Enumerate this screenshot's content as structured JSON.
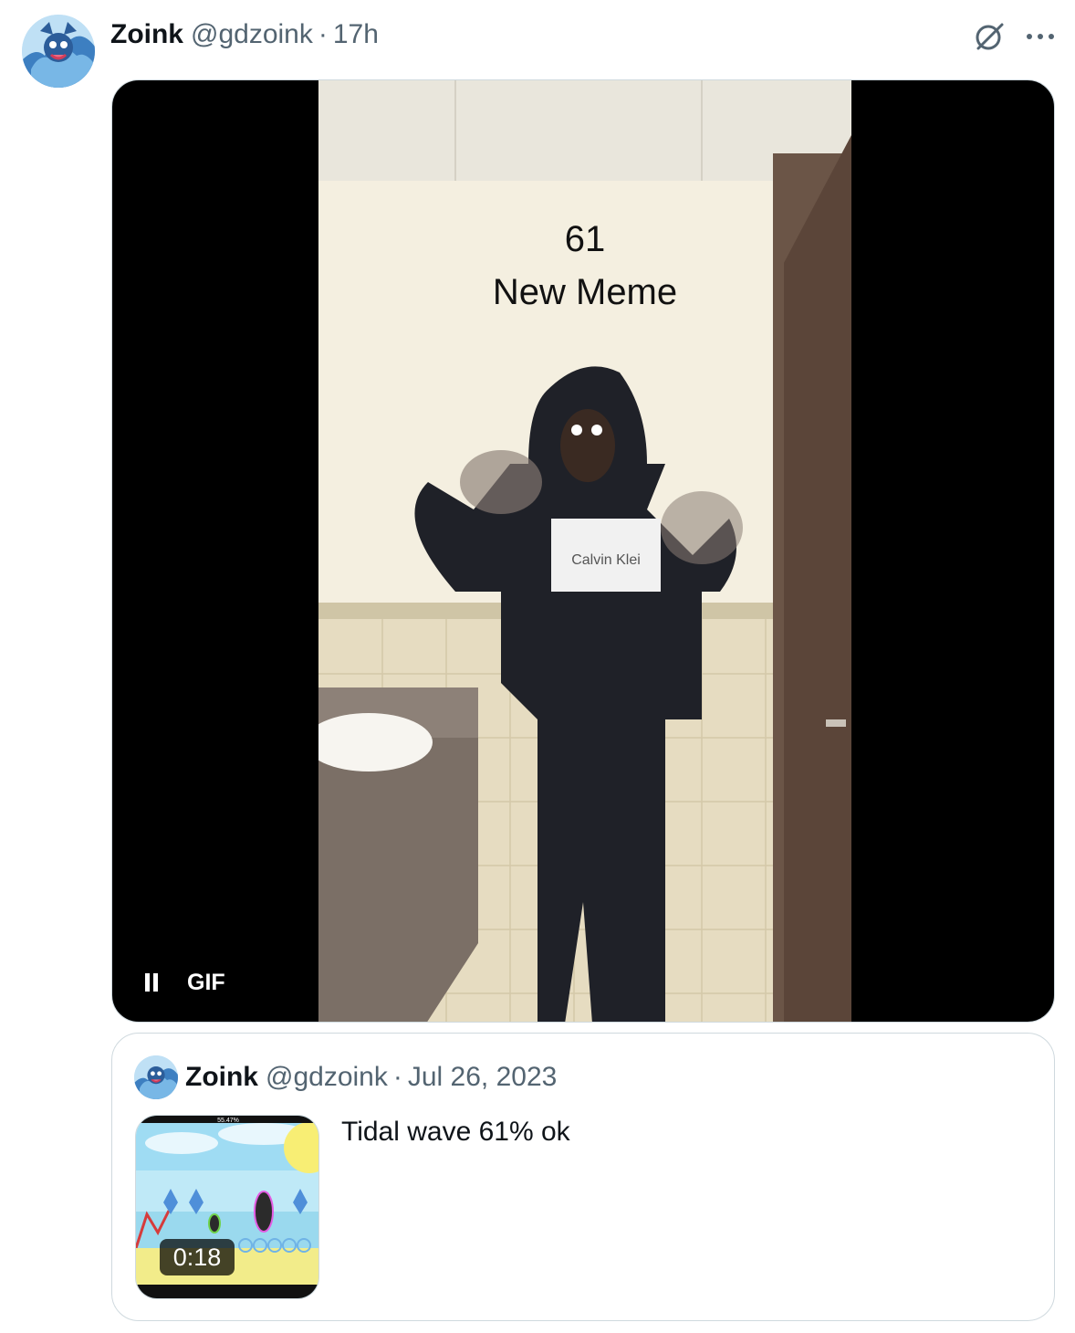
{
  "tweet": {
    "author_name": "Zoink",
    "author_handle": "@gdzoink",
    "separator": "·",
    "time": "17h",
    "media": {
      "overlay_line1": "61",
      "overlay_line2": "New Meme",
      "hoodie_text": "Calvin Klei",
      "gif_label": "GIF",
      "state": "playing"
    }
  },
  "quoted_tweet": {
    "author_name": "Zoink",
    "author_handle": "@gdzoink",
    "separator": "·",
    "date": "Jul 26, 2023",
    "text": "Tidal wave 61% ok",
    "thumbnail": {
      "duration": "0:18",
      "progress_label": "55.47%"
    }
  },
  "colors": {
    "text_primary": "#0f1419",
    "text_secondary": "#536471",
    "border": "#cfd9de",
    "media_bg": "#000000"
  },
  "icons": [
    "avatar",
    "grok-icon",
    "more-icon",
    "pause-icon"
  ]
}
